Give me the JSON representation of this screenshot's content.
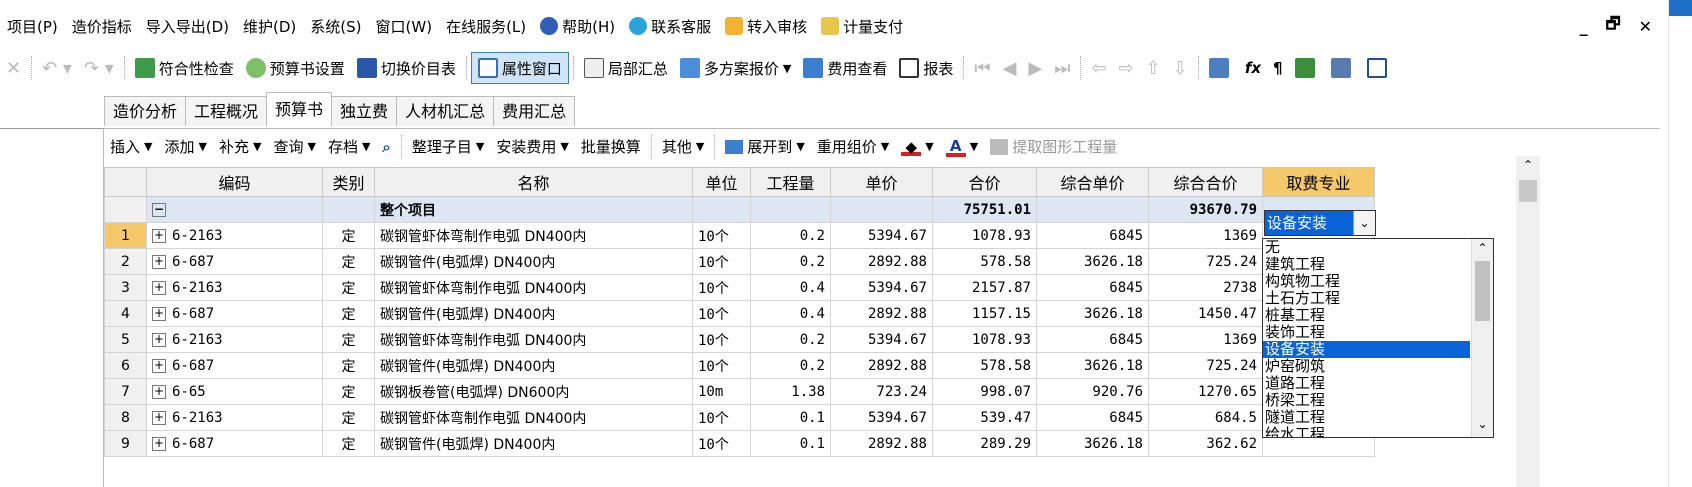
{
  "menu": {
    "items": [
      "项目(P)",
      "造价指标",
      "导入导出(D)",
      "维护(D)",
      "系统(S)",
      "窗口(W)",
      "在线服务(L)",
      "帮助(H)",
      "联系客服",
      "转入审核",
      "计量支付"
    ],
    "window_controls": [
      "_",
      "🗗",
      "✕"
    ]
  },
  "toolbar": {
    "items": [
      "符合性检查",
      "预算书设置",
      "切换价目表",
      "属性窗口",
      "局部汇总",
      "多方案报价",
      "费用查看",
      "报表"
    ],
    "active": "属性窗口"
  },
  "tabs": [
    "造价分析",
    "工程概况",
    "预算书",
    "独立费",
    "人材机汇总",
    "费用汇总"
  ],
  "active_tab": "预算书",
  "subbar": {
    "items": [
      "插入",
      "添加",
      "补充",
      "查询",
      "存档",
      "整理子目",
      "安装费用",
      "批量换算",
      "其他",
      "展开到",
      "重用组价",
      "提取图形工程量"
    ]
  },
  "grid": {
    "headers": [
      "编码",
      "类别",
      "名称",
      "单位",
      "工程量",
      "单价",
      "合价",
      "综合单价",
      "综合合价",
      "取费专业"
    ],
    "project_row": {
      "name": "整个项目",
      "total": "75751.01",
      "comp_total": "93670.79"
    },
    "rows": [
      {
        "n": "1",
        "code": "6-2163",
        "type": "定",
        "name": "碳钢管虾体弯制作电弧 DN400内",
        "unit": "10个",
        "qty": "0.2",
        "price": "5394.67",
        "total": "1078.93",
        "comp_price": "6845",
        "comp_total": "1369"
      },
      {
        "n": "2",
        "code": "6-687",
        "type": "定",
        "name": "碳钢管件(电弧焊) DN400内",
        "unit": "10个",
        "qty": "0.2",
        "price": "2892.88",
        "total": "578.58",
        "comp_price": "3626.18",
        "comp_total": "725.24"
      },
      {
        "n": "3",
        "code": "6-2163",
        "type": "定",
        "name": "碳钢管虾体弯制作电弧 DN400内",
        "unit": "10个",
        "qty": "0.4",
        "price": "5394.67",
        "total": "2157.87",
        "comp_price": "6845",
        "comp_total": "2738"
      },
      {
        "n": "4",
        "code": "6-687",
        "type": "定",
        "name": "碳钢管件(电弧焊) DN400内",
        "unit": "10个",
        "qty": "0.4",
        "price": "2892.88",
        "total": "1157.15",
        "comp_price": "3626.18",
        "comp_total": "1450.47"
      },
      {
        "n": "5",
        "code": "6-2163",
        "type": "定",
        "name": "碳钢管虾体弯制作电弧 DN400内",
        "unit": "10个",
        "qty": "0.2",
        "price": "5394.67",
        "total": "1078.93",
        "comp_price": "6845",
        "comp_total": "1369"
      },
      {
        "n": "6",
        "code": "6-687",
        "type": "定",
        "name": "碳钢管件(电弧焊) DN400内",
        "unit": "10个",
        "qty": "0.2",
        "price": "2892.88",
        "total": "578.58",
        "comp_price": "3626.18",
        "comp_total": "725.24"
      },
      {
        "n": "7",
        "code": "6-65",
        "type": "定",
        "name": "碳钢板卷管(电弧焊) DN600内",
        "unit": "10m",
        "qty": "1.38",
        "price": "723.24",
        "total": "998.07",
        "comp_price": "920.76",
        "comp_total": "1270.65"
      },
      {
        "n": "8",
        "code": "6-2163",
        "type": "定",
        "name": "碳钢管虾体弯制作电弧 DN400内",
        "unit": "10个",
        "qty": "0.1",
        "price": "5394.67",
        "total": "539.47",
        "comp_price": "6845",
        "comp_total": "684.5"
      },
      {
        "n": "9",
        "code": "6-687",
        "type": "定",
        "name": "碳钢管件(电弧焊) DN400内",
        "unit": "10个",
        "qty": "0.1",
        "price": "2892.88",
        "total": "289.29",
        "comp_price": "3626.18",
        "comp_total": "362.62"
      }
    ]
  },
  "fee_select": {
    "value": "设备安装",
    "options": [
      "无",
      "建筑工程",
      "构筑物工程",
      "土石方工程",
      "桩基工程",
      "装饰工程",
      "设备安装",
      "炉窑砌筑",
      "道路工程",
      "桥梁工程",
      "隧道工程",
      "给水工程"
    ],
    "selected_index": 6
  },
  "colors": {
    "accent_header": "#f5c969",
    "selection": "#0a64d8",
    "project_row": "#dde6f3"
  }
}
